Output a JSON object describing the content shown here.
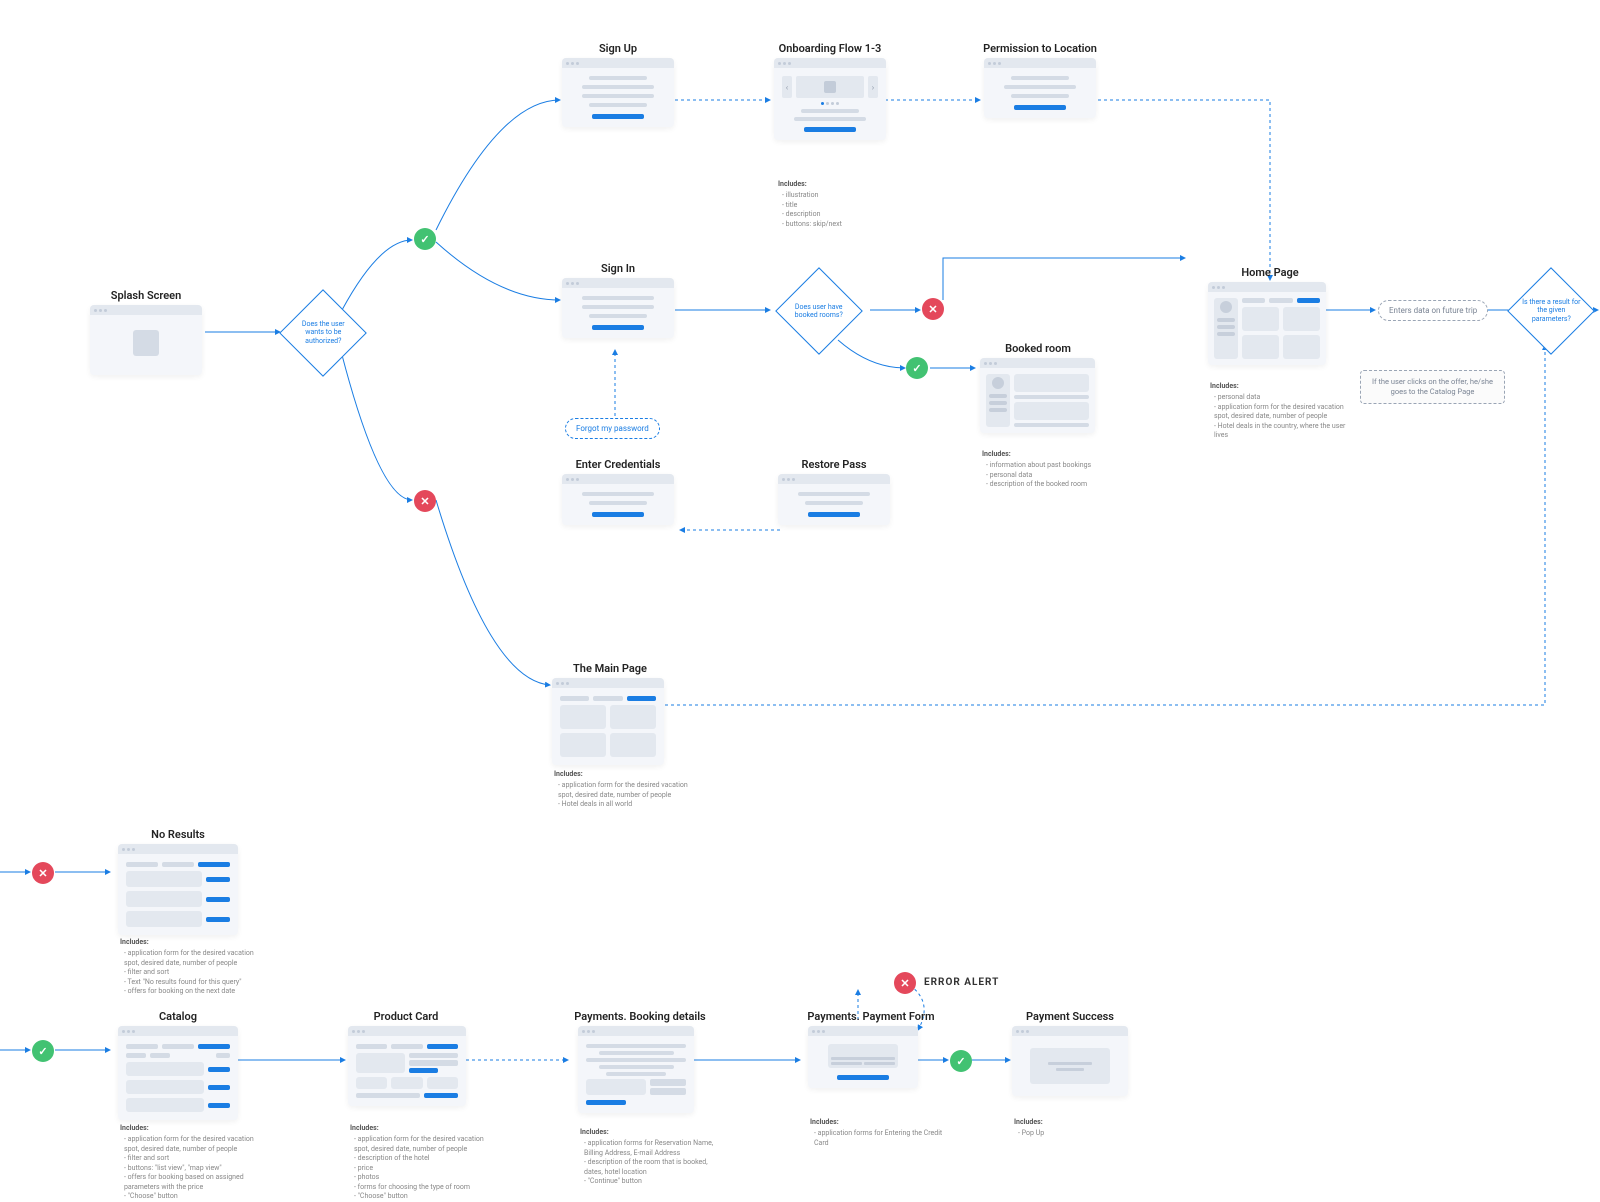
{
  "nodes": {
    "splash": {
      "title": "Splash Screen"
    },
    "signup": {
      "title": "Sign Up"
    },
    "onboarding": {
      "title": "Onboarding Flow 1-3"
    },
    "permission": {
      "title": "Permission to Location"
    },
    "signin": {
      "title": "Sign In"
    },
    "forgot": {
      "label": "Forgot my password"
    },
    "enter_creds": {
      "title": "Enter Credentials"
    },
    "restore": {
      "title": "Restore Pass"
    },
    "booked_room": {
      "title": "Booked room"
    },
    "home": {
      "title": "Home Page"
    },
    "main_page": {
      "title": "The Main Page"
    },
    "no_results": {
      "title": "No Results"
    },
    "catalog": {
      "title": "Catalog"
    },
    "product_card": {
      "title": "Product Card"
    },
    "pay_booking": {
      "title": "Payments. Booking details"
    },
    "pay_form": {
      "title": "Payments. Payment Form"
    },
    "pay_success": {
      "title": "Payment Success"
    }
  },
  "decisions": {
    "authorized": "Does the user wants to be authorized?",
    "booked": "Does user have booked rooms?",
    "result": "Is there a result for the given parameters?"
  },
  "pills": {
    "enters_data": "Enters data on future trip"
  },
  "infos": {
    "offer_click": "If the user clicks on the offer, he/she goes to the Catalog Page"
  },
  "notes": {
    "includes_label": "Includes:",
    "onboarding": [
      "- illustration",
      "- title",
      "- description",
      "- buttons: skip/next"
    ],
    "booked_room": [
      "- information about past bookings",
      "- personal data",
      "- description of the booked room"
    ],
    "home": [
      "- personal data",
      "- application form for the desired vacation spot, desired date, number of people",
      "- Hotel deals in the country, where the user lives"
    ],
    "main_page": [
      "- application form for the desired  vacation spot, desired date, number of people",
      "- Hotel deals in all world"
    ],
    "no_results": [
      "- application form for the desired  vacation spot, desired date, number of people",
      "- filter and sort",
      "- Text \"No results found for this query\"",
      "- offers for booking on the next date"
    ],
    "catalog": [
      "- application form for the desired  vacation spot, desired date, number of people",
      "- filter and sort",
      "- buttons: \"list view\", \"map view\"",
      "- offers for booking based on assigned parameters with the price",
      "- \"Choose\" button"
    ],
    "product_card": [
      "- application form for the desired  vacation spot, desired date, number of people",
      "- description of the hotel",
      "- price",
      "- photos",
      "- forms for choosing the type of room",
      "- \"Choose\" button"
    ],
    "pay_booking": [
      "- application forms for Reservation Name, Billing Address, E-mail Address",
      "- description of the room that is booked, dates, hotel location",
      "- \"Continue\" button"
    ],
    "pay_form": [
      "- application forms for Entering the Credit Card"
    ],
    "pay_success": [
      "- Pop Up"
    ]
  },
  "error_alert": "ERROR ALERT"
}
